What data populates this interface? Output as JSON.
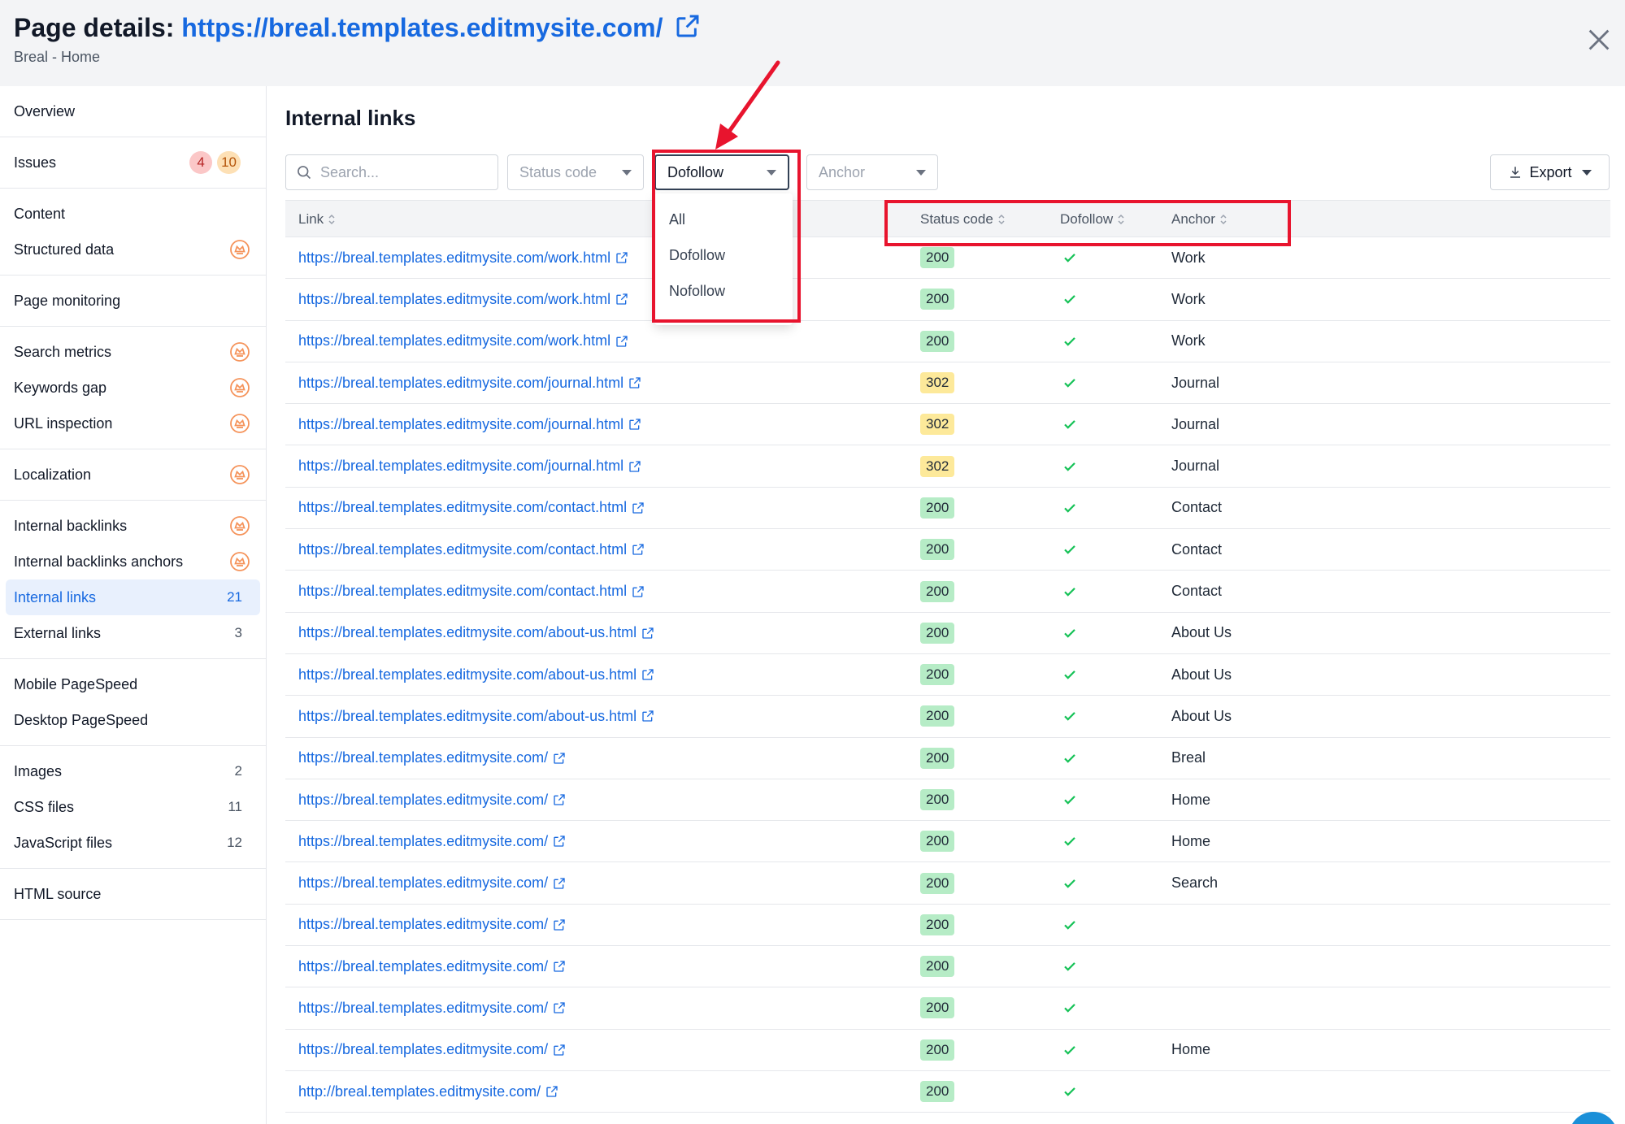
{
  "header": {
    "title_prefix": "Page details:",
    "title_url": "https://breal.templates.editmysite.com/",
    "subtitle": "Breal - Home"
  },
  "sidebar": {
    "groups": [
      [
        {
          "label": "Overview"
        }
      ],
      [
        {
          "label": "Issues",
          "badges": [
            "4",
            "10"
          ]
        }
      ],
      [
        {
          "label": "Content"
        },
        {
          "label": "Structured data",
          "premium": true
        }
      ],
      [
        {
          "label": "Page monitoring"
        }
      ],
      [
        {
          "label": "Search metrics",
          "premium": true
        },
        {
          "label": "Keywords gap",
          "premium": true
        },
        {
          "label": "URL inspection",
          "premium": true
        }
      ],
      [
        {
          "label": "Localization",
          "premium": true
        }
      ],
      [
        {
          "label": "Internal backlinks",
          "premium": true
        },
        {
          "label": "Internal backlinks anchors",
          "premium": true
        },
        {
          "label": "Internal links",
          "count": "21",
          "active": true
        },
        {
          "label": "External links",
          "count": "3"
        }
      ],
      [
        {
          "label": "Mobile PageSpeed"
        },
        {
          "label": "Desktop PageSpeed"
        }
      ],
      [
        {
          "label": "Images",
          "count": "2"
        },
        {
          "label": "CSS files",
          "count": "11"
        },
        {
          "label": "JavaScript files",
          "count": "12"
        }
      ],
      [
        {
          "label": "HTML source"
        }
      ]
    ]
  },
  "main": {
    "title": "Internal links",
    "search_placeholder": "Search...",
    "filters": {
      "status_code": "Status code",
      "dofollow": "Dofollow",
      "anchor": "Anchor"
    },
    "dropdown_options": [
      "All",
      "Dofollow",
      "Nofollow"
    ],
    "export_label": "Export",
    "columns": {
      "link": "Link",
      "status": "Status code",
      "dofollow": "Dofollow",
      "anchor": "Anchor"
    },
    "rows": [
      {
        "link": "https://breal.templates.editmysite.com/work.html",
        "status": "200",
        "dofollow": true,
        "anchor": "Work"
      },
      {
        "link": "https://breal.templates.editmysite.com/work.html",
        "status": "200",
        "dofollow": true,
        "anchor": "Work"
      },
      {
        "link": "https://breal.templates.editmysite.com/work.html",
        "status": "200",
        "dofollow": true,
        "anchor": "Work"
      },
      {
        "link": "https://breal.templates.editmysite.com/journal.html",
        "status": "302",
        "dofollow": true,
        "anchor": "Journal"
      },
      {
        "link": "https://breal.templates.editmysite.com/journal.html",
        "status": "302",
        "dofollow": true,
        "anchor": "Journal"
      },
      {
        "link": "https://breal.templates.editmysite.com/journal.html",
        "status": "302",
        "dofollow": true,
        "anchor": "Journal"
      },
      {
        "link": "https://breal.templates.editmysite.com/contact.html",
        "status": "200",
        "dofollow": true,
        "anchor": "Contact"
      },
      {
        "link": "https://breal.templates.editmysite.com/contact.html",
        "status": "200",
        "dofollow": true,
        "anchor": "Contact"
      },
      {
        "link": "https://breal.templates.editmysite.com/contact.html",
        "status": "200",
        "dofollow": true,
        "anchor": "Contact"
      },
      {
        "link": "https://breal.templates.editmysite.com/about-us.html",
        "status": "200",
        "dofollow": true,
        "anchor": "About Us"
      },
      {
        "link": "https://breal.templates.editmysite.com/about-us.html",
        "status": "200",
        "dofollow": true,
        "anchor": "About Us"
      },
      {
        "link": "https://breal.templates.editmysite.com/about-us.html",
        "status": "200",
        "dofollow": true,
        "anchor": "About Us"
      },
      {
        "link": "https://breal.templates.editmysite.com/",
        "status": "200",
        "dofollow": true,
        "anchor": "Breal"
      },
      {
        "link": "https://breal.templates.editmysite.com/",
        "status": "200",
        "dofollow": true,
        "anchor": "Home"
      },
      {
        "link": "https://breal.templates.editmysite.com/",
        "status": "200",
        "dofollow": true,
        "anchor": "Home"
      },
      {
        "link": "https://breal.templates.editmysite.com/",
        "status": "200",
        "dofollow": true,
        "anchor": "Search"
      },
      {
        "link": "https://breal.templates.editmysite.com/",
        "status": "200",
        "dofollow": true,
        "anchor": ""
      },
      {
        "link": "https://breal.templates.editmysite.com/",
        "status": "200",
        "dofollow": true,
        "anchor": ""
      },
      {
        "link": "https://breal.templates.editmysite.com/",
        "status": "200",
        "dofollow": true,
        "anchor": ""
      },
      {
        "link": "https://breal.templates.editmysite.com/",
        "status": "200",
        "dofollow": true,
        "anchor": "Home"
      },
      {
        "link": "http://breal.templates.editmysite.com/",
        "status": "200",
        "dofollow": true,
        "anchor": ""
      }
    ]
  },
  "colors": {
    "accent": "#1769e0",
    "status_200": "#b6ecc6",
    "status_302": "#fde99a",
    "check": "#16c257",
    "annotation": "#e8142e"
  }
}
